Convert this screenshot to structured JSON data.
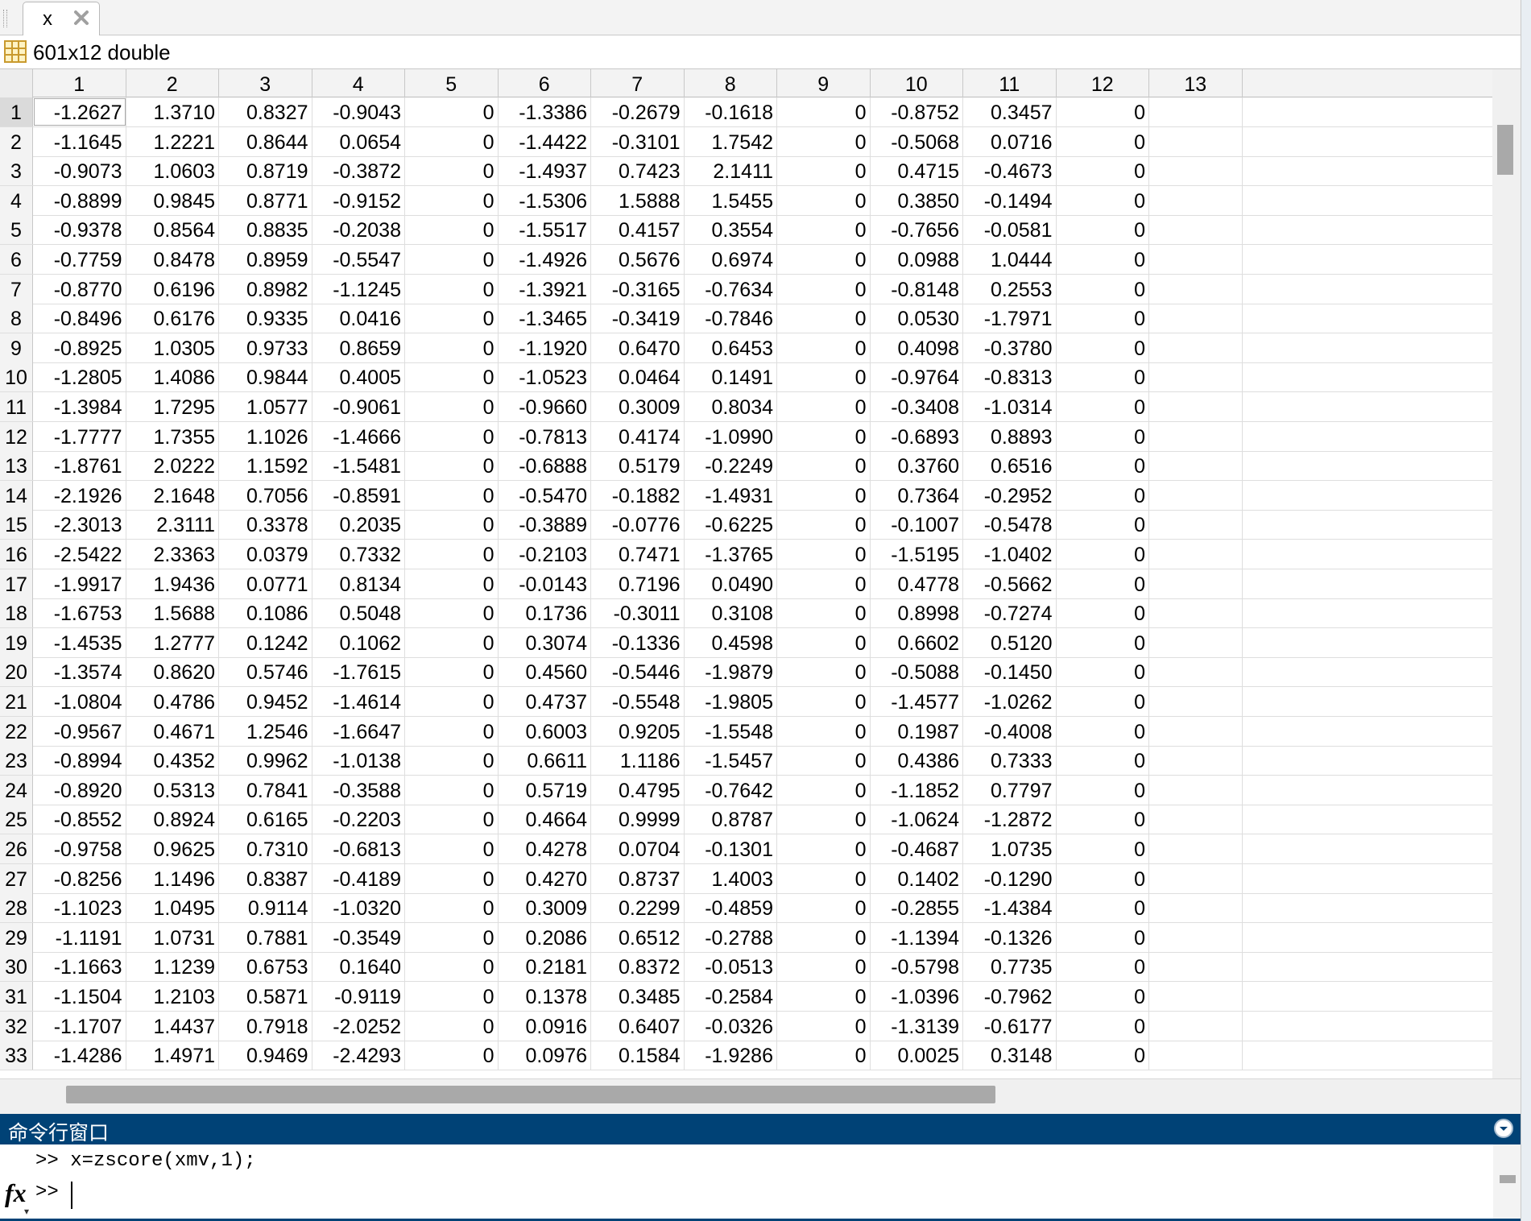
{
  "tab": {
    "label": "x"
  },
  "info": {
    "size_text": "601x12 double"
  },
  "columns": [
    "1",
    "2",
    "3",
    "4",
    "5",
    "6",
    "7",
    "8",
    "9",
    "10",
    "11",
    "12",
    "13"
  ],
  "rows": [
    {
      "n": "1",
      "v": [
        "-1.2627",
        "1.3710",
        "0.8327",
        "-0.9043",
        "0",
        "-1.3386",
        "-0.2679",
        "-0.1618",
        "0",
        "-0.8752",
        "0.3457",
        "0",
        ""
      ]
    },
    {
      "n": "2",
      "v": [
        "-1.1645",
        "1.2221",
        "0.8644",
        "0.0654",
        "0",
        "-1.4422",
        "-0.3101",
        "1.7542",
        "0",
        "-0.5068",
        "0.0716",
        "0",
        ""
      ]
    },
    {
      "n": "3",
      "v": [
        "-0.9073",
        "1.0603",
        "0.8719",
        "-0.3872",
        "0",
        "-1.4937",
        "0.7423",
        "2.1411",
        "0",
        "0.4715",
        "-0.4673",
        "0",
        ""
      ]
    },
    {
      "n": "4",
      "v": [
        "-0.8899",
        "0.9845",
        "0.8771",
        "-0.9152",
        "0",
        "-1.5306",
        "1.5888",
        "1.5455",
        "0",
        "0.3850",
        "-0.1494",
        "0",
        ""
      ]
    },
    {
      "n": "5",
      "v": [
        "-0.9378",
        "0.8564",
        "0.8835",
        "-0.2038",
        "0",
        "-1.5517",
        "0.4157",
        "0.3554",
        "0",
        "-0.7656",
        "-0.0581",
        "0",
        ""
      ]
    },
    {
      "n": "6",
      "v": [
        "-0.7759",
        "0.8478",
        "0.8959",
        "-0.5547",
        "0",
        "-1.4926",
        "0.5676",
        "0.6974",
        "0",
        "0.0988",
        "1.0444",
        "0",
        ""
      ]
    },
    {
      "n": "7",
      "v": [
        "-0.8770",
        "0.6196",
        "0.8982",
        "-1.1245",
        "0",
        "-1.3921",
        "-0.3165",
        "-0.7634",
        "0",
        "-0.8148",
        "0.2553",
        "0",
        ""
      ]
    },
    {
      "n": "8",
      "v": [
        "-0.8496",
        "0.6176",
        "0.9335",
        "0.0416",
        "0",
        "-1.3465",
        "-0.3419",
        "-0.7846",
        "0",
        "0.0530",
        "-1.7971",
        "0",
        ""
      ]
    },
    {
      "n": "9",
      "v": [
        "-0.8925",
        "1.0305",
        "0.9733",
        "0.8659",
        "0",
        "-1.1920",
        "0.6470",
        "0.6453",
        "0",
        "0.4098",
        "-0.3780",
        "0",
        ""
      ]
    },
    {
      "n": "10",
      "v": [
        "-1.2805",
        "1.4086",
        "0.9844",
        "0.4005",
        "0",
        "-1.0523",
        "0.0464",
        "0.1491",
        "0",
        "-0.9764",
        "-0.8313",
        "0",
        ""
      ]
    },
    {
      "n": "11",
      "v": [
        "-1.3984",
        "1.7295",
        "1.0577",
        "-0.9061",
        "0",
        "-0.9660",
        "0.3009",
        "0.8034",
        "0",
        "-0.3408",
        "-1.0314",
        "0",
        ""
      ]
    },
    {
      "n": "12",
      "v": [
        "-1.7777",
        "1.7355",
        "1.1026",
        "-1.4666",
        "0",
        "-0.7813",
        "0.4174",
        "-1.0990",
        "0",
        "-0.6893",
        "0.8893",
        "0",
        ""
      ]
    },
    {
      "n": "13",
      "v": [
        "-1.8761",
        "2.0222",
        "1.1592",
        "-1.5481",
        "0",
        "-0.6888",
        "0.5179",
        "-0.2249",
        "0",
        "0.3760",
        "0.6516",
        "0",
        ""
      ]
    },
    {
      "n": "14",
      "v": [
        "-2.1926",
        "2.1648",
        "0.7056",
        "-0.8591",
        "0",
        "-0.5470",
        "-0.1882",
        "-1.4931",
        "0",
        "0.7364",
        "-0.2952",
        "0",
        ""
      ]
    },
    {
      "n": "15",
      "v": [
        "-2.3013",
        "2.3111",
        "0.3378",
        "0.2035",
        "0",
        "-0.3889",
        "-0.0776",
        "-0.6225",
        "0",
        "-0.1007",
        "-0.5478",
        "0",
        ""
      ]
    },
    {
      "n": "16",
      "v": [
        "-2.5422",
        "2.3363",
        "0.0379",
        "0.7332",
        "0",
        "-0.2103",
        "0.7471",
        "-1.3765",
        "0",
        "-1.5195",
        "-1.0402",
        "0",
        ""
      ]
    },
    {
      "n": "17",
      "v": [
        "-1.9917",
        "1.9436",
        "0.0771",
        "0.8134",
        "0",
        "-0.0143",
        "0.7196",
        "0.0490",
        "0",
        "0.4778",
        "-0.5662",
        "0",
        ""
      ]
    },
    {
      "n": "18",
      "v": [
        "-1.6753",
        "1.5688",
        "0.1086",
        "0.5048",
        "0",
        "0.1736",
        "-0.3011",
        "0.3108",
        "0",
        "0.8998",
        "-0.7274",
        "0",
        ""
      ]
    },
    {
      "n": "19",
      "v": [
        "-1.4535",
        "1.2777",
        "0.1242",
        "0.1062",
        "0",
        "0.3074",
        "-0.1336",
        "0.4598",
        "0",
        "0.6602",
        "0.5120",
        "0",
        ""
      ]
    },
    {
      "n": "20",
      "v": [
        "-1.3574",
        "0.8620",
        "0.5746",
        "-1.7615",
        "0",
        "0.4560",
        "-0.5446",
        "-1.9879",
        "0",
        "-0.5088",
        "-0.1450",
        "0",
        ""
      ]
    },
    {
      "n": "21",
      "v": [
        "-1.0804",
        "0.4786",
        "0.9452",
        "-1.4614",
        "0",
        "0.4737",
        "-0.5548",
        "-1.9805",
        "0",
        "-1.4577",
        "-1.0262",
        "0",
        ""
      ]
    },
    {
      "n": "22",
      "v": [
        "-0.9567",
        "0.4671",
        "1.2546",
        "-1.6647",
        "0",
        "0.6003",
        "0.9205",
        "-1.5548",
        "0",
        "0.1987",
        "-0.4008",
        "0",
        ""
      ]
    },
    {
      "n": "23",
      "v": [
        "-0.8994",
        "0.4352",
        "0.9962",
        "-1.0138",
        "0",
        "0.6611",
        "1.1186",
        "-1.5457",
        "0",
        "0.4386",
        "0.7333",
        "0",
        ""
      ]
    },
    {
      "n": "24",
      "v": [
        "-0.8920",
        "0.5313",
        "0.7841",
        "-0.3588",
        "0",
        "0.5719",
        "0.4795",
        "-0.7642",
        "0",
        "-1.1852",
        "0.7797",
        "0",
        ""
      ]
    },
    {
      "n": "25",
      "v": [
        "-0.8552",
        "0.8924",
        "0.6165",
        "-0.2203",
        "0",
        "0.4664",
        "0.9999",
        "0.8787",
        "0",
        "-1.0624",
        "-1.2872",
        "0",
        ""
      ]
    },
    {
      "n": "26",
      "v": [
        "-0.9758",
        "0.9625",
        "0.7310",
        "-0.6813",
        "0",
        "0.4278",
        "0.0704",
        "-0.1301",
        "0",
        "-0.4687",
        "1.0735",
        "0",
        ""
      ]
    },
    {
      "n": "27",
      "v": [
        "-0.8256",
        "1.1496",
        "0.8387",
        "-0.4189",
        "0",
        "0.4270",
        "0.8737",
        "1.4003",
        "0",
        "0.1402",
        "-0.1290",
        "0",
        ""
      ]
    },
    {
      "n": "28",
      "v": [
        "-1.1023",
        "1.0495",
        "0.9114",
        "-1.0320",
        "0",
        "0.3009",
        "0.2299",
        "-0.4859",
        "0",
        "-0.2855",
        "-1.4384",
        "0",
        ""
      ]
    },
    {
      "n": "29",
      "v": [
        "-1.1191",
        "1.0731",
        "0.7881",
        "-0.3549",
        "0",
        "0.2086",
        "0.6512",
        "-0.2788",
        "0",
        "-1.1394",
        "-0.1326",
        "0",
        ""
      ]
    },
    {
      "n": "30",
      "v": [
        "-1.1663",
        "1.1239",
        "0.6753",
        "0.1640",
        "0",
        "0.2181",
        "0.8372",
        "-0.0513",
        "0",
        "-0.5798",
        "0.7735",
        "0",
        ""
      ]
    },
    {
      "n": "31",
      "v": [
        "-1.1504",
        "1.2103",
        "0.5871",
        "-0.9119",
        "0",
        "0.1378",
        "0.3485",
        "-0.2584",
        "0",
        "-1.0396",
        "-0.7962",
        "0",
        ""
      ]
    },
    {
      "n": "32",
      "v": [
        "-1.1707",
        "1.4437",
        "0.7918",
        "-2.0252",
        "0",
        "0.0916",
        "0.6407",
        "-0.0326",
        "0",
        "-1.3139",
        "-0.6177",
        "0",
        ""
      ]
    },
    {
      "n": "33",
      "v": [
        "-1.4286",
        "1.4971",
        "0.9469",
        "-2.4293",
        "0",
        "0.0976",
        "0.1584",
        "-1.9286",
        "0",
        "0.0025",
        "0.3148",
        "0",
        ""
      ]
    }
  ],
  "command_window": {
    "title": "命令行窗口",
    "history_line": ">> x=zscore(xmv,1);",
    "prompt": ">>",
    "input_value": ""
  },
  "icons": {
    "tab_close": "close-icon",
    "variable": "grid-variable-icon",
    "cmd_menu": "chevron-down-circle-icon",
    "fx": "fx-function-icon"
  },
  "colors": {
    "cmd_title_bg": "#004276",
    "accent": "#004276"
  }
}
